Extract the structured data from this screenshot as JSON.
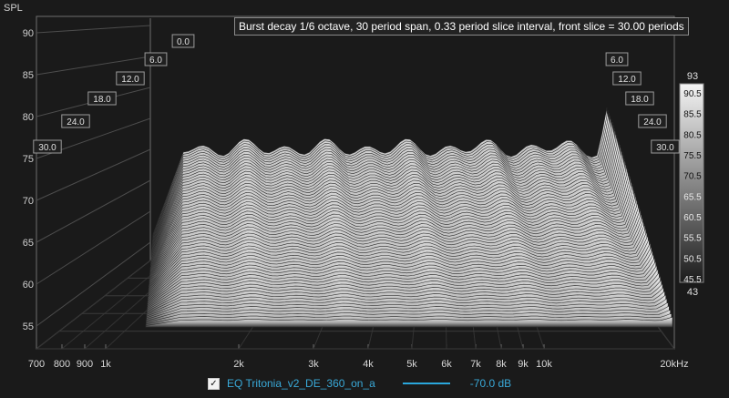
{
  "chart_data": {
    "type": "waterfall",
    "title": "Burst decay 1/6 octave, 30 period span, 0.33 period slice interval,  front slice = 30.00 periods",
    "ylabel": "SPL",
    "xlabel": "",
    "x_unit": "kHz",
    "x_ticks": [
      "700",
      "800",
      "900",
      "1k",
      "2k",
      "3k",
      "4k",
      "5k",
      "6k",
      "7k",
      "8k",
      "9k",
      "10k",
      "20kHz"
    ],
    "y_ticks": [
      "90",
      "85",
      "80",
      "75",
      "70",
      "65",
      "60",
      "55"
    ],
    "period_ticks": [
      "0.0",
      "6.0",
      "12.0",
      "18.0",
      "24.0",
      "30.0"
    ],
    "colorbar": {
      "max": "93",
      "min": "43",
      "ticks": [
        "90.5",
        "85.5",
        "80.5",
        "75.5",
        "70.5",
        "65.5",
        "60.5",
        "55.5",
        "50.5",
        "45.5"
      ]
    },
    "front_slice_periods": 30.0,
    "slice_interval_periods": 0.33,
    "span_periods": 30
  },
  "legend": {
    "checked": true,
    "series_name": "EQ Tritonia_v2_DE_360_on_a",
    "level": "-70.0 dB"
  },
  "colors": {
    "background": "#1a1a1a",
    "grid": "#6f6f6f",
    "legend_text": "#39a9d8",
    "surface_top": "#f0f0f0",
    "surface_bottom": "#3c3c3c"
  }
}
